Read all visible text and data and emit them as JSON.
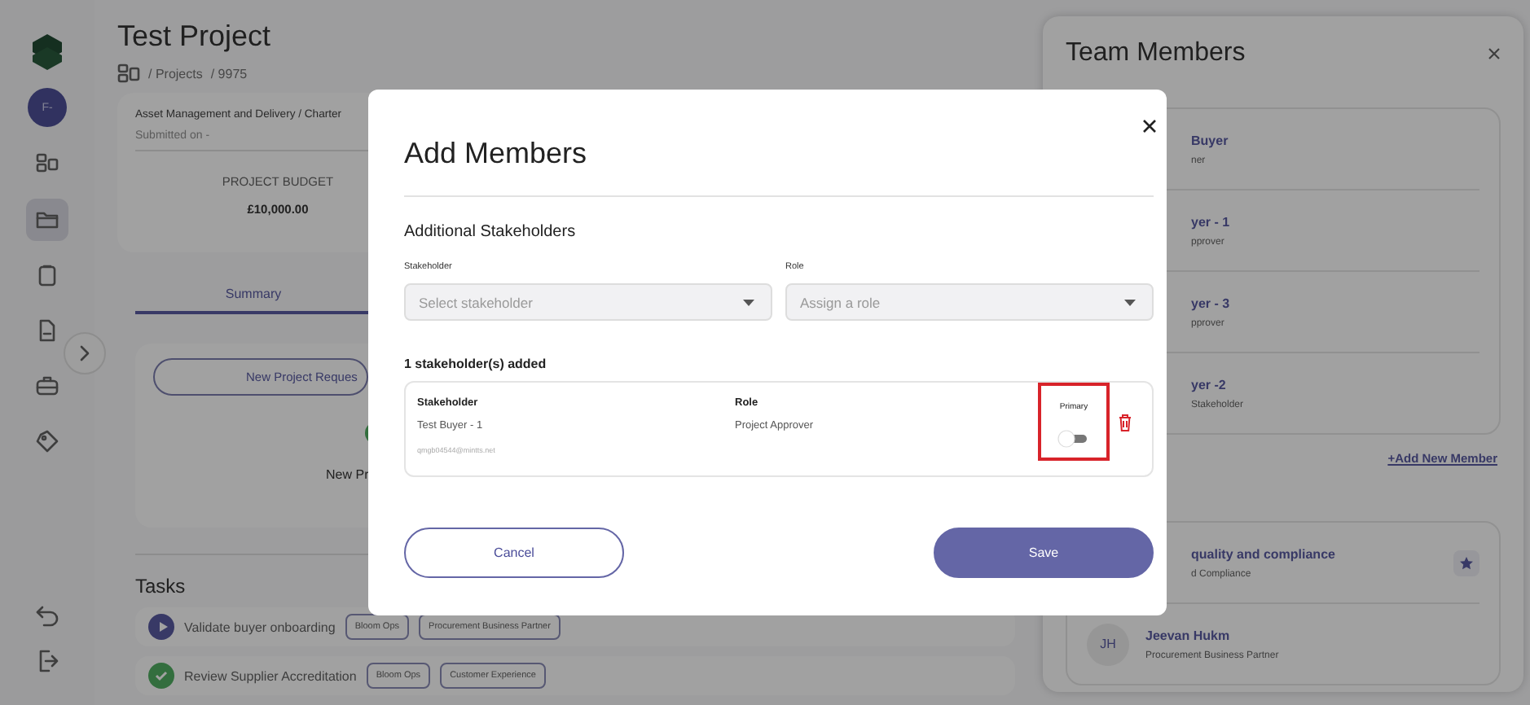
{
  "sidebar": {
    "avatar": "F-",
    "items": [
      {
        "kind": "dashboard",
        "selected": false
      },
      {
        "kind": "folder",
        "selected": true
      },
      {
        "kind": "clipboard",
        "selected": false
      },
      {
        "kind": "document",
        "selected": false
      },
      {
        "kind": "briefcase",
        "selected": false
      },
      {
        "kind": "tag",
        "selected": false
      }
    ],
    "bottom_items": [
      {
        "kind": "undo"
      },
      {
        "kind": "logout"
      }
    ]
  },
  "header": {
    "title": "Test Project",
    "breadcrumb": [
      {
        "label": "/ Projects"
      },
      {
        "label": "/ 9975"
      }
    ]
  },
  "project_card": {
    "category": "Asset Management and Delivery / Charter",
    "submitted": "Submitted on -",
    "budget_label": "PROJECT BUDGET",
    "budget": "£10,000.00"
  },
  "tabs": [
    {
      "label": "Summary",
      "selected": true
    }
  ],
  "summary": {
    "button": "New Project Reques",
    "status": "New Pr"
  },
  "tasks": {
    "title": "Tasks",
    "rows": [
      {
        "kind": "in_progress",
        "name": "Validate buyer onboarding",
        "tags": [
          "Bloom Ops",
          "Procurement Business Partner"
        ]
      },
      {
        "kind": "done",
        "name": "Review Supplier Accreditation",
        "tags": [
          "Bloom Ops",
          "Customer Experience"
        ]
      }
    ]
  },
  "team_panel": {
    "title": "Team Members",
    "stakeholders": [
      {
        "name": "Buyer",
        "role": "ner"
      },
      {
        "name": "yer - 1",
        "role": "pprover"
      },
      {
        "name": "yer - 3",
        "role": "pprover"
      },
      {
        "name": "yer -2",
        "role": "Stakeholder"
      }
    ],
    "add_link": "+Add New Member",
    "members": [
      {
        "name": "quality and compliance",
        "role": "d Compliance",
        "starred": true
      },
      {
        "avatar": "JH",
        "name": "Jeevan Hukm",
        "role": "Procurement Business Partner",
        "starred": false
      }
    ]
  },
  "modal": {
    "title": "Add Members",
    "section": "Additional Stakeholders",
    "fields": [
      {
        "label": "Stakeholder",
        "placeholder": "Select stakeholder"
      },
      {
        "label": "Role",
        "placeholder": "Assign a role"
      }
    ],
    "added_count": "1 stakeholder(s) added",
    "columns": [
      "Stakeholder",
      "Role",
      "Primary"
    ],
    "added": [
      {
        "name": "Test Buyer - 1",
        "email": "qmgb04544@mintts.net",
        "role": "Project Approver",
        "primary": false,
        "highlighted": true
      }
    ],
    "buttons": [
      {
        "label": "Cancel",
        "kind": "secondary"
      },
      {
        "label": "Save",
        "kind": "primary"
      }
    ]
  }
}
